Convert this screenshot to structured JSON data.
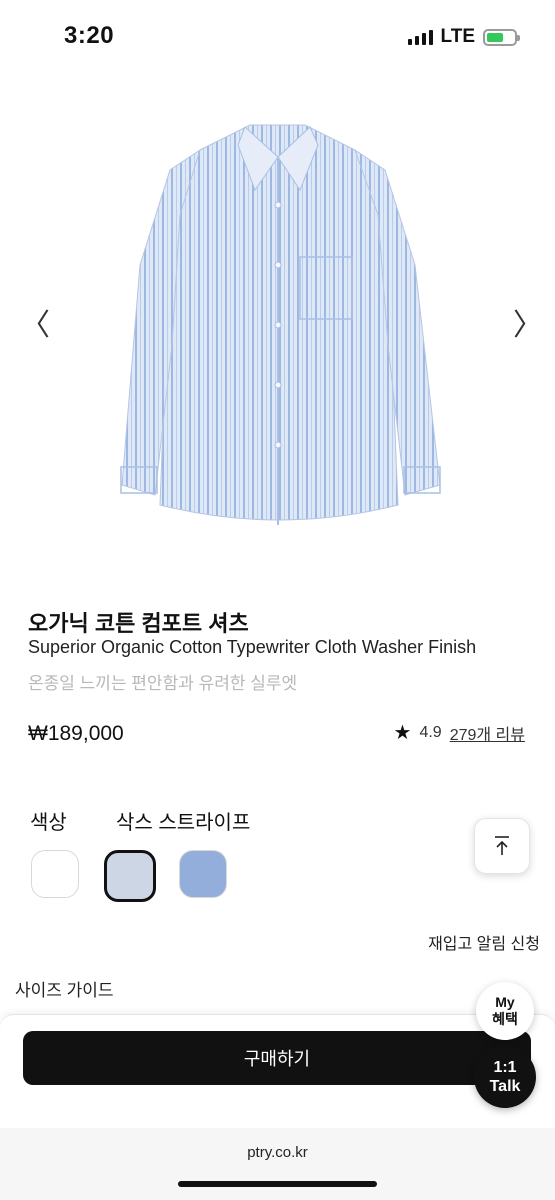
{
  "status_bar": {
    "time": "3:20",
    "network": "LTE",
    "battery_level": 0.62
  },
  "gallery": {
    "prev_icon": "〈",
    "next_icon": "〉"
  },
  "product": {
    "name_ko": "오가닉 코튼 컴포트 셔츠",
    "name_en": "Superior Organic Cotton Typewriter Cloth Washer Finish",
    "tagline": "온종일 느끼는 편안함과 유려한 실루엣",
    "price": "₩189,000",
    "rating": "4.9",
    "review_count": "279개 리뷰"
  },
  "options": {
    "color_label": "색상",
    "selected_color": "삭스 스트라이프",
    "swatches": [
      "#ffffff",
      "#cdd6e4",
      "#93aedb"
    ]
  },
  "links": {
    "restock": "재입고 알림 신청",
    "size_guide": "사이즈 가이드"
  },
  "actions": {
    "buy": "구매하기",
    "my_benefits_line1": "My",
    "my_benefits_line2": "혜택",
    "talk_line1": "1:1",
    "talk_line2": "Talk"
  },
  "browser": {
    "url": "ptry.co.kr"
  }
}
